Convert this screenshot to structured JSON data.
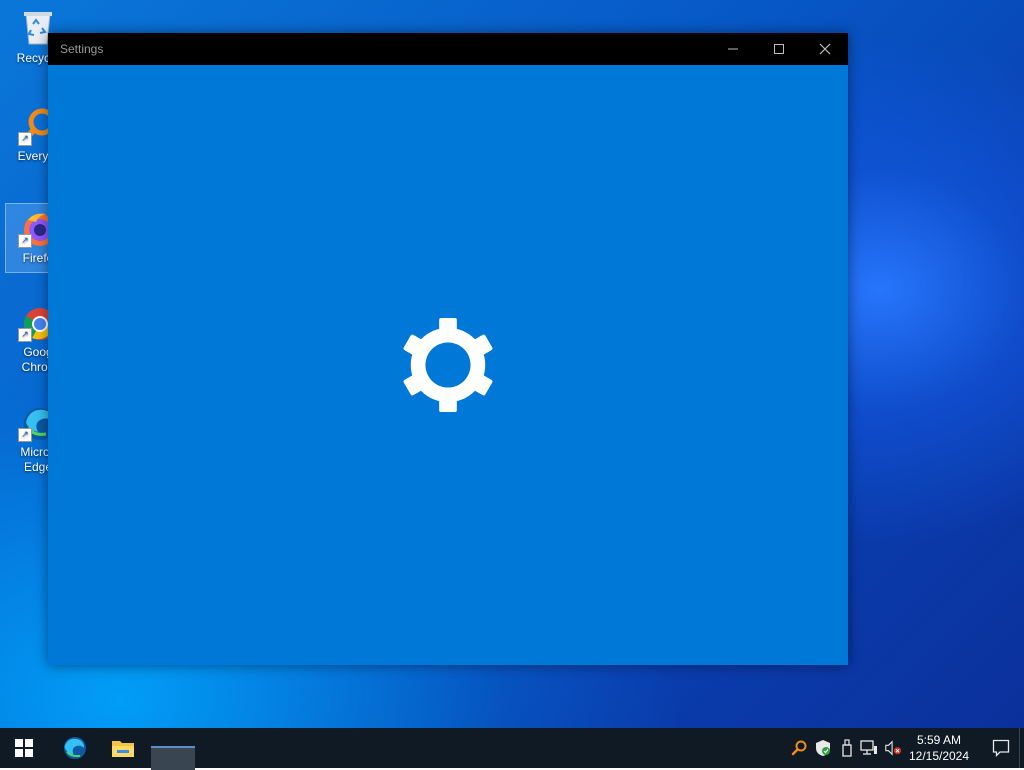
{
  "desktop": {
    "icons": [
      {
        "label": "Recycle",
        "name": "recycle-bin"
      },
      {
        "label": "Everyth",
        "name": "everything"
      },
      {
        "label": "Firefo",
        "name": "firefox"
      },
      {
        "label_line1": "Goog",
        "label_line2": "Chron",
        "name": "google-chrome"
      },
      {
        "label_line1": "Micros",
        "label_line2": "Edge",
        "name": "microsoft-edge"
      }
    ]
  },
  "window": {
    "title": "Settings",
    "controls": [
      "minimize",
      "maximize",
      "close"
    ],
    "background_color": "#0078d7",
    "splash_icon": "gear-icon"
  },
  "taskbar": {
    "pinned": [
      "start-icon",
      "edge-icon",
      "file-explorer-icon",
      "active-app"
    ],
    "tray": [
      "everything-search-icon",
      "windows-security-icon",
      "usb-eject-icon",
      "network-icon",
      "volume-muted-icon"
    ],
    "clock": {
      "time": "5:59 AM",
      "date": "12/15/2024"
    }
  }
}
